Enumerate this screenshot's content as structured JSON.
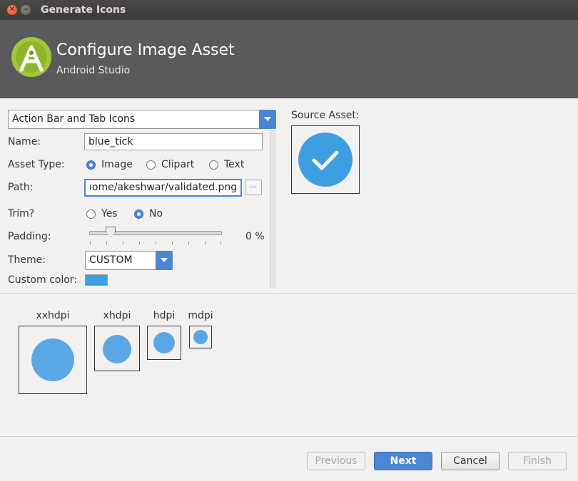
{
  "window": {
    "title": "Generate Icons"
  },
  "header": {
    "title": "Configure Image Asset",
    "subtitle": "Android Studio"
  },
  "icon_type_select": {
    "value": "Action Bar and Tab Icons"
  },
  "form": {
    "name_label": "Name:",
    "name_value": "blue_tick",
    "asset_type_label": "Asset Type:",
    "asset_type_options": [
      "Image",
      "Clipart",
      "Text"
    ],
    "asset_type_selected": "Image",
    "path_label": "Path:",
    "path_value": "ıome/akeshwar/validated.png",
    "browse_label": "...",
    "trim_label": "Trim?",
    "trim_options": [
      "Yes",
      "No"
    ],
    "trim_selected": "No",
    "padding_label": "Padding:",
    "padding_value": "0 %",
    "theme_label": "Theme:",
    "theme_value": "CUSTOM",
    "custom_color_label": "Custom color:",
    "custom_color": "#3d9ee0"
  },
  "source_asset": {
    "label": "Source Asset:",
    "icon": "check-circle-icon",
    "color": "#3d9ee0"
  },
  "previews": {
    "labels": [
      "xxhdpi",
      "xhdpi",
      "hdpi",
      "mdpi"
    ],
    "color": "#5aa7e6"
  },
  "footer": {
    "previous": "Previous",
    "next": "Next",
    "cancel": "Cancel",
    "finish": "Finish"
  },
  "colors": {
    "accent": "#4a86d4",
    "header_bg": "#5a5a5a",
    "android_green": "#a4c639"
  }
}
